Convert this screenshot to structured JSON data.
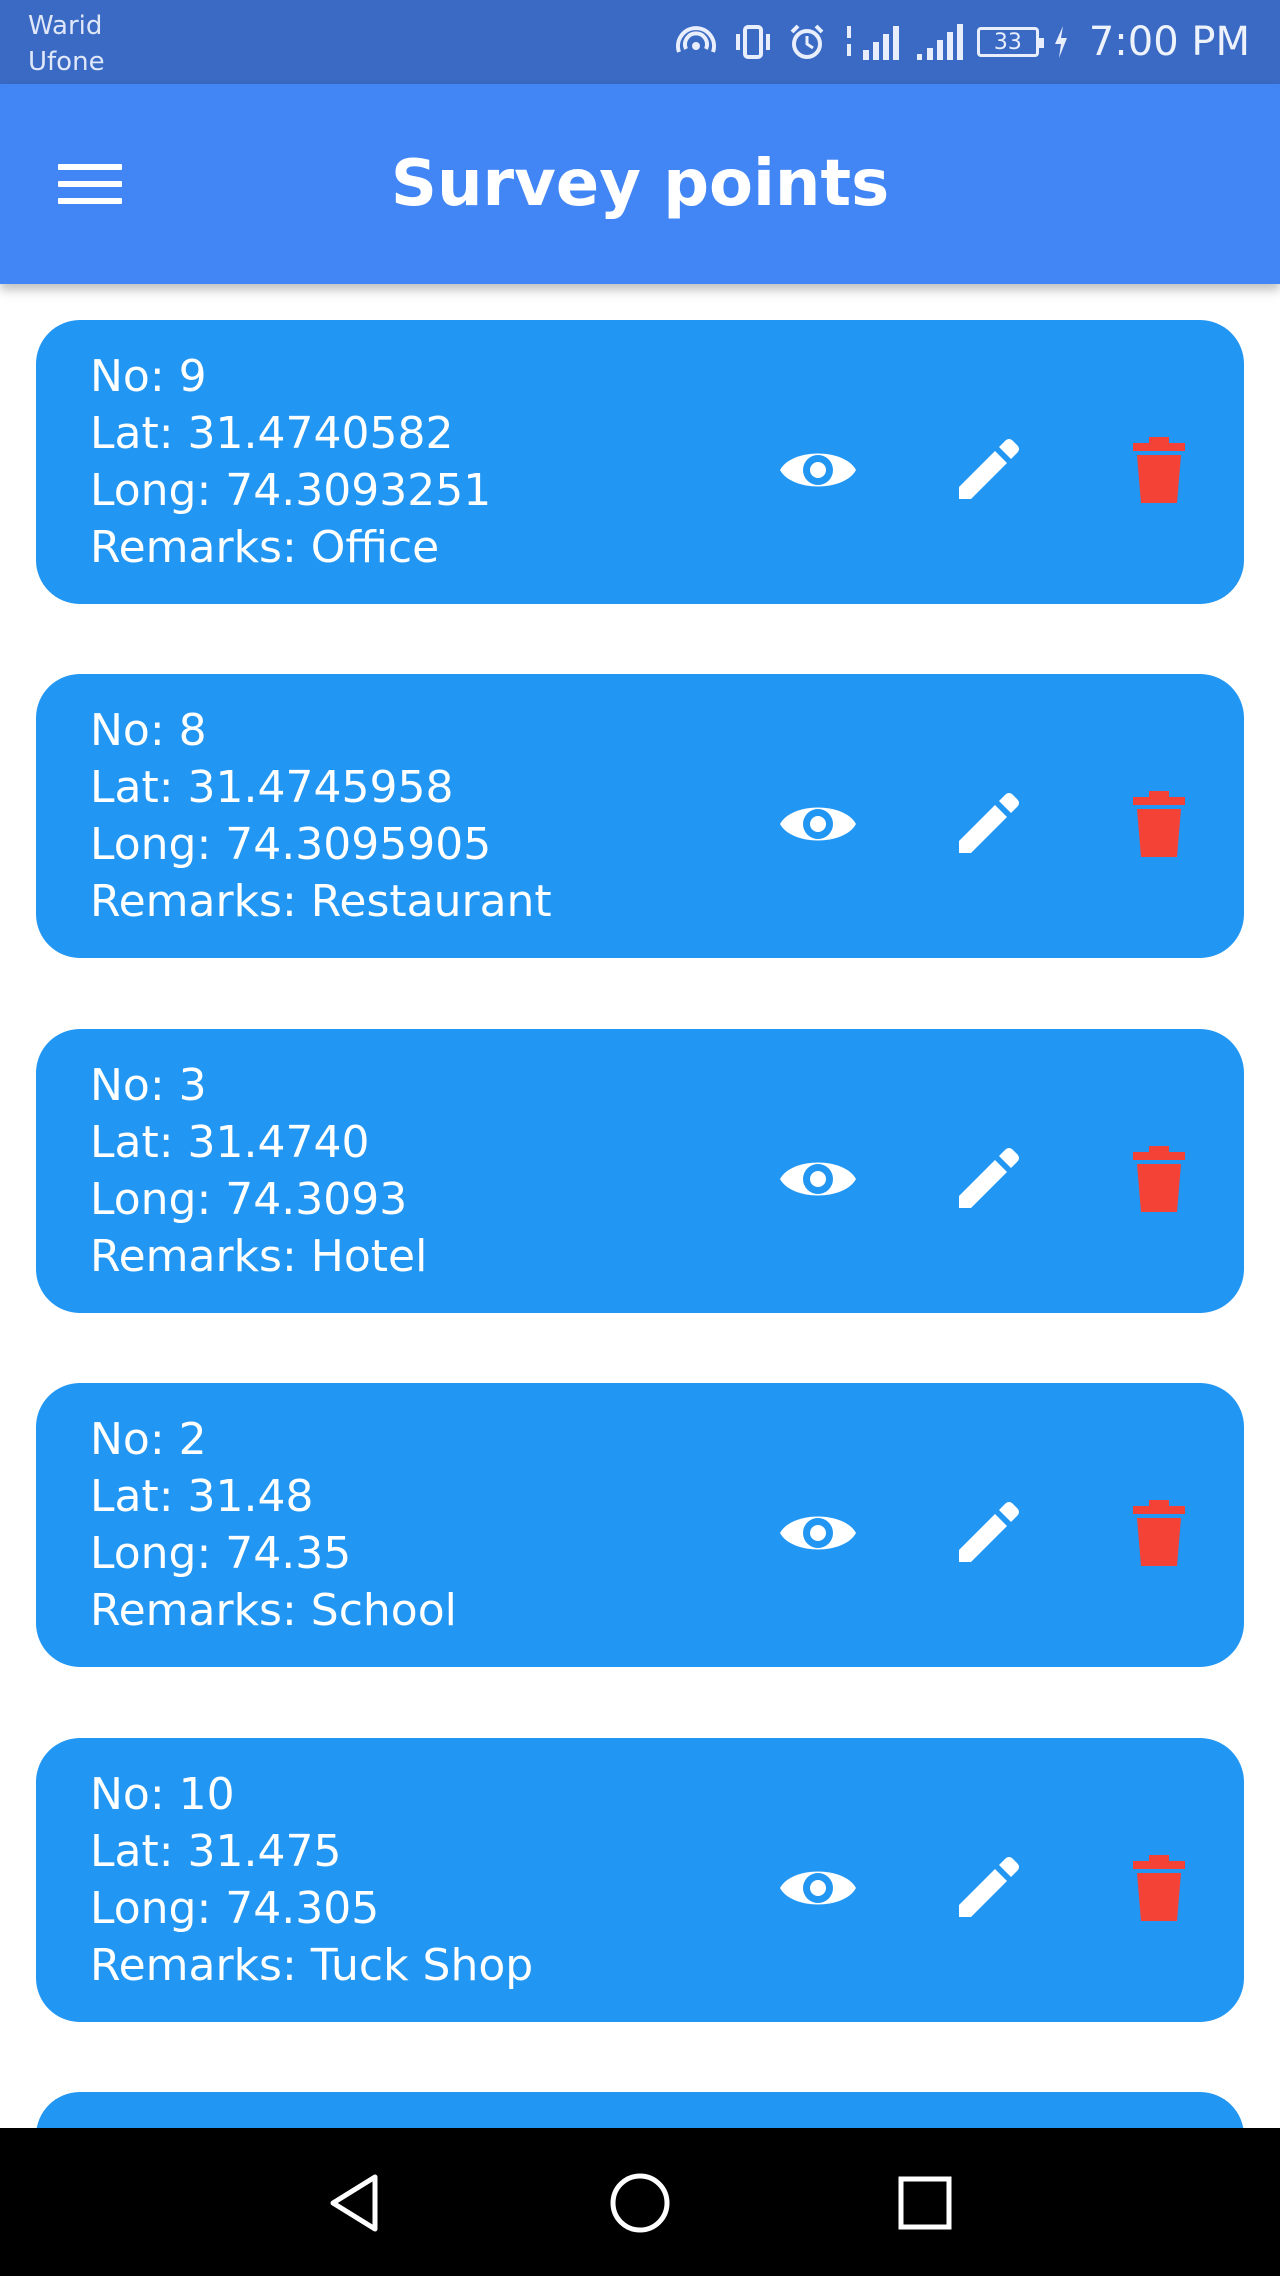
{
  "status_bar": {
    "carrier_1": "Warid",
    "carrier_2": "Ufone",
    "battery": "33",
    "time": "7:00 PM"
  },
  "app_bar": {
    "title": "Survey points",
    "menu_icon": "hamburger-menu-icon"
  },
  "colors": {
    "app_bar": "#4285f4",
    "card": "#2196f3",
    "delete_icon": "#f44336",
    "status_bar": "#3a6ac4"
  },
  "survey_points": [
    {
      "no": "No: 9",
      "lat": "Lat: 31.4740582",
      "long": "Long: 74.3093251",
      "remarks": "Remarks: Office"
    },
    {
      "no": "No: 8",
      "lat": "Lat: 31.4745958",
      "long": "Long: 74.3095905",
      "remarks": "Remarks: Restaurant"
    },
    {
      "no": "No: 3",
      "lat": "Lat: 31.4740",
      "long": "Long: 74.3093",
      "remarks": "Remarks: Hotel"
    },
    {
      "no": "No: 2",
      "lat": "Lat: 31.48",
      "long": "Long: 74.35",
      "remarks": "Remarks: School"
    },
    {
      "no": "No: 10",
      "lat": "Lat: 31.475",
      "long": "Long: 74.305",
      "remarks": "Remarks: Tuck Shop"
    }
  ],
  "actions": [
    "eye-icon",
    "pencil-icon",
    "trash-icon"
  ],
  "nav_bar": [
    "back-icon",
    "home-icon",
    "recent-apps-icon"
  ]
}
